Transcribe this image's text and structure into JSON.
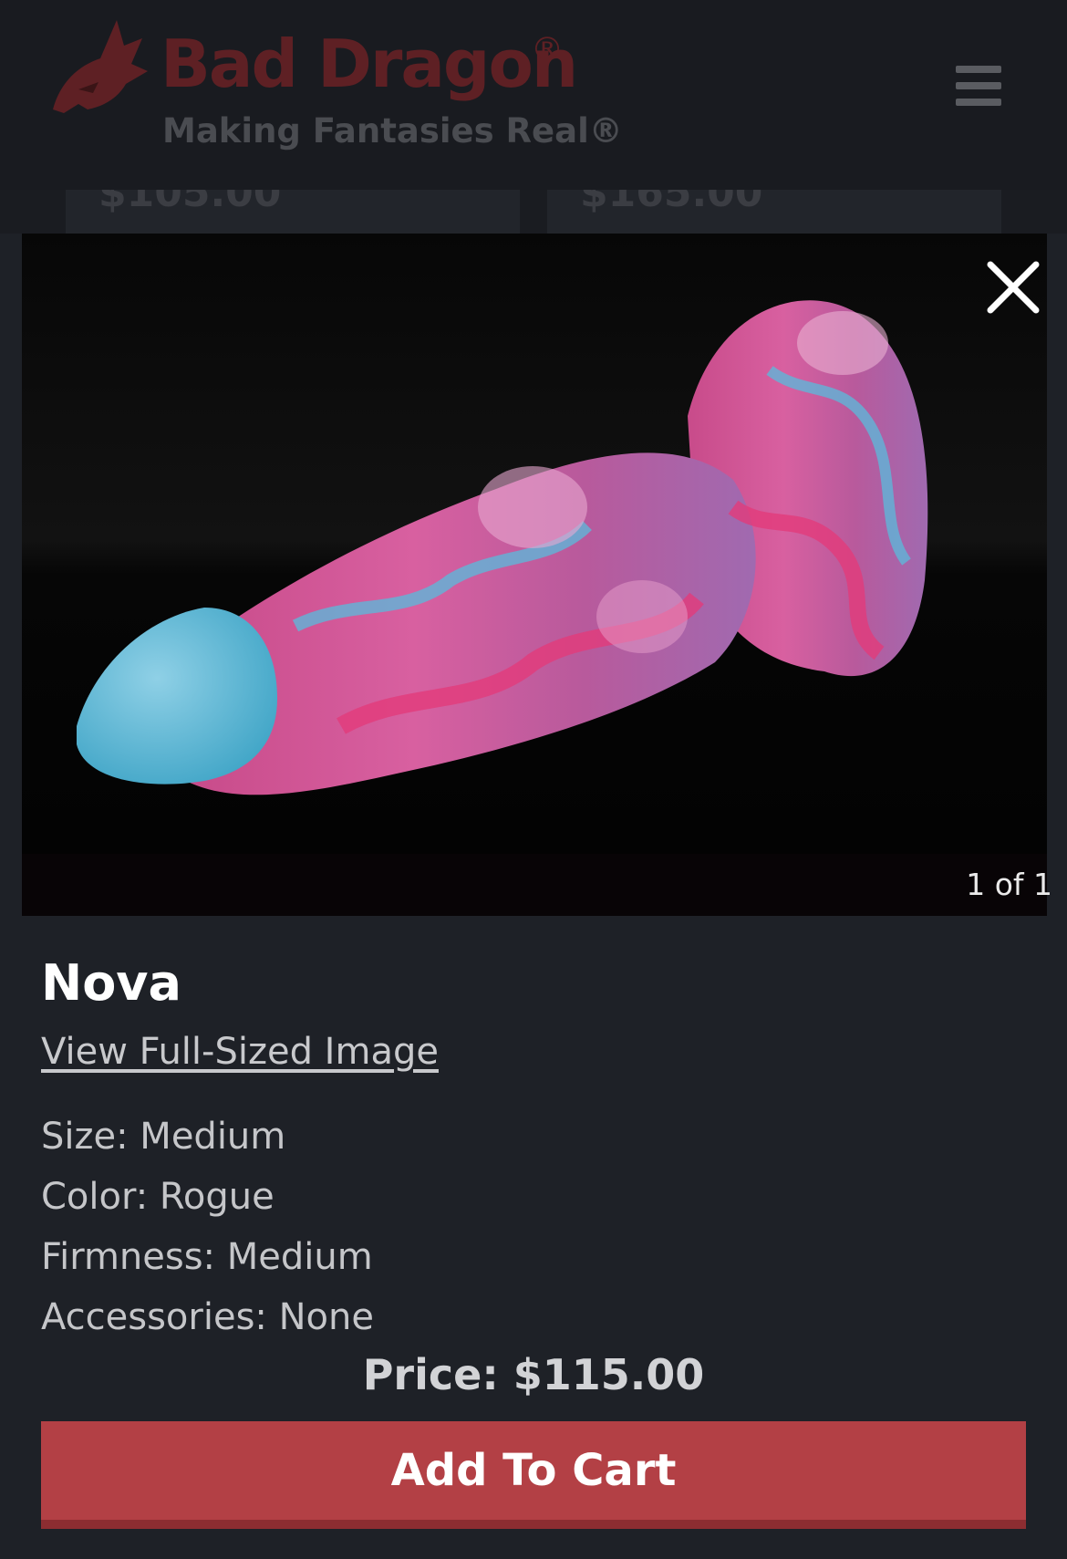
{
  "header": {
    "brand": "Bad Dragon",
    "brand_mark": "®",
    "tagline": "Making Fantasies Real®",
    "logo_icon": "dragon-head-icon",
    "menu_icon": "hamburger-menu-icon"
  },
  "background_listing": {
    "prices": [
      "$105.00",
      "$165.00"
    ]
  },
  "modal": {
    "close_icon": "close-icon",
    "image_counter": "1 of 1",
    "product_title": "Nova",
    "view_full_image_label": "View Full-Sized Image",
    "specs": [
      "Size: Medium",
      "Color: Rogue",
      "Firmness: Medium",
      "Accessories: None"
    ],
    "price": "Price: $115.00",
    "add_to_cart_label": "Add To Cart"
  },
  "colors": {
    "background": "#1e2127",
    "accent": "#b34045",
    "brand_dim": "#5e2024"
  }
}
